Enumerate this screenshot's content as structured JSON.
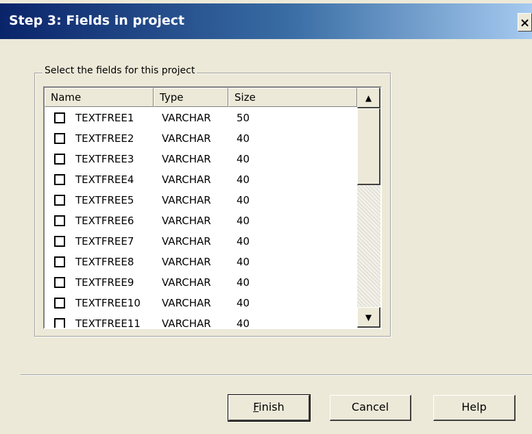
{
  "window": {
    "title": "Step 3: Fields in project",
    "close_label": "×"
  },
  "groupbox": {
    "legend": "Select the fields for this project"
  },
  "listview": {
    "columns": [
      {
        "label": "Name"
      },
      {
        "label": "Type"
      },
      {
        "label": "Size"
      }
    ],
    "rows": [
      {
        "name": "TEXTFREE1",
        "type": "VARCHAR",
        "size": "50",
        "checked": false
      },
      {
        "name": "TEXTFREE2",
        "type": "VARCHAR",
        "size": "40",
        "checked": false
      },
      {
        "name": "TEXTFREE3",
        "type": "VARCHAR",
        "size": "40",
        "checked": false
      },
      {
        "name": "TEXTFREE4",
        "type": "VARCHAR",
        "size": "40",
        "checked": false
      },
      {
        "name": "TEXTFREE5",
        "type": "VARCHAR",
        "size": "40",
        "checked": false
      },
      {
        "name": "TEXTFREE6",
        "type": "VARCHAR",
        "size": "40",
        "checked": false
      },
      {
        "name": "TEXTFREE7",
        "type": "VARCHAR",
        "size": "40",
        "checked": false
      },
      {
        "name": "TEXTFREE8",
        "type": "VARCHAR",
        "size": "40",
        "checked": false
      },
      {
        "name": "TEXTFREE9",
        "type": "VARCHAR",
        "size": "40",
        "checked": false
      },
      {
        "name": "TEXTFREE10",
        "type": "VARCHAR",
        "size": "40",
        "checked": false
      },
      {
        "name": "TEXTFREE11",
        "type": "VARCHAR",
        "size": "40",
        "checked": false
      }
    ],
    "scroll_up_icon": "▲",
    "scroll_down_icon": "▼"
  },
  "buttons": {
    "finish_mnemonic": "F",
    "finish_rest": "inish",
    "cancel": "Cancel",
    "help": "Help"
  },
  "colors": {
    "titlebar_start": "#0A246A",
    "titlebar_end": "#A6CAF0",
    "face": "#ECE9D8"
  }
}
